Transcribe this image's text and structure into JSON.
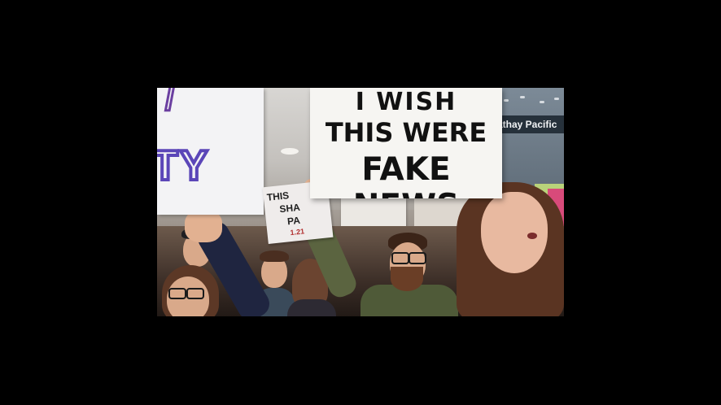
{
  "photo": {
    "signs": {
      "main": {
        "line1": "I WISH",
        "line2": "THIS WERE",
        "line3": "FAKE NEWS"
      },
      "left": {
        "fragment_top": "/",
        "fragment_main": "TY"
      },
      "small": {
        "line1": "THIS",
        "line2": "SHA",
        "line3": "PA",
        "line4": "1.21"
      },
      "background_banner": "athay Pacific"
    }
  },
  "colors": {
    "background": "#000000",
    "left_sign_ink": "#5b46b8",
    "main_sign_ink": "#111111"
  }
}
